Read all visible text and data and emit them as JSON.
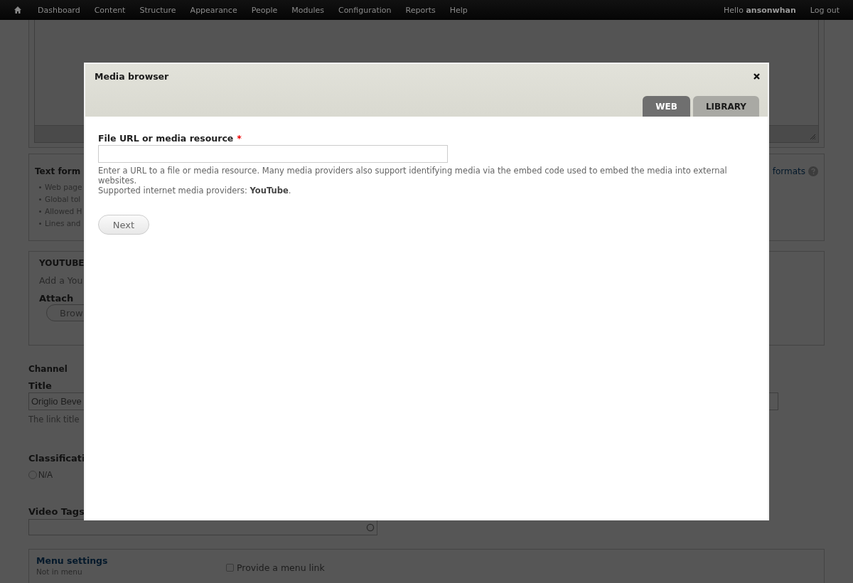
{
  "toolbar": {
    "menu_items": [
      "Dashboard",
      "Content",
      "Structure",
      "Appearance",
      "People",
      "Modules",
      "Configuration",
      "Reports",
      "Help"
    ],
    "greeting": "Hello **ansonwhan**",
    "logout": "Log out"
  },
  "page": {
    "text_format": {
      "label": "Text form",
      "items": [
        "Web page",
        "Global tol",
        "Allowed H",
        "Lines and"
      ],
      "link": "formats"
    },
    "youtube": {
      "title": "YOUTUBE",
      "description": "Add a You",
      "attach_label": "Attach",
      "button": "Brow"
    },
    "channel": {
      "heading": "Channel",
      "title_label": "Title",
      "title_value": "Origlio Beve",
      "help": "The link title"
    },
    "classification": {
      "label": "Classificati",
      "options": [
        {
          "label": "N/A",
          "selected": false
        }
      ]
    },
    "video_tags": {
      "label": "Video Tags"
    },
    "menu_settings": {
      "title": "Menu settings",
      "summary": "Not in menu",
      "checkbox": {
        "label": "Provide a menu link",
        "checked": false
      }
    }
  },
  "dialog": {
    "title": "Media browser",
    "tabs": [
      {
        "label": "WEB",
        "selected": true
      },
      {
        "label": "LIBRARY",
        "selected": false
      }
    ],
    "field": {
      "label": "File URL or media resource",
      "required_mark": "*"
    },
    "description": "Enter a URL to a file or media resource. Many media providers also support identifying media via the embed code used to embed the media into external websites.",
    "providers": "Supported internet media providers: **YouTube**.",
    "button": "Next"
  }
}
